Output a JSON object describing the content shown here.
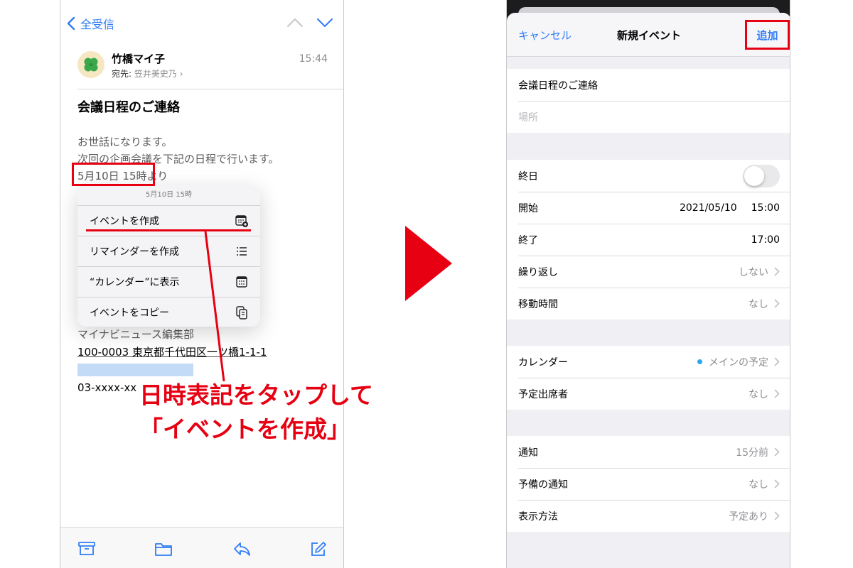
{
  "colors": {
    "accent_blue": "#2f7cf6",
    "annotation_red": "#e60012",
    "calendar_dot": "#29a8f0"
  },
  "mail": {
    "back_label": "全受信",
    "sender": {
      "name": "竹橋マイ子",
      "to_label": "宛先:",
      "to_name": "笠井美史乃",
      "time": "15:44",
      "avatar_icon": "clover-icon"
    },
    "subject": "会議日程のご連絡",
    "body": {
      "line1": "お世話になります。",
      "line2": "次回の企画会議を下記の日程で行います。",
      "date_link": "5月10日 15時",
      "date_suffix": "より",
      "sig1": "マイナビニュース編集部",
      "sig2": "100-0003 東京都千代田区一ツ橋1-1-1",
      "phone": "03-xxxx-xx"
    },
    "context_menu": {
      "header": "5月10日 15時",
      "items": [
        {
          "label": "イベントを作成",
          "icon": "calendar-add-icon"
        },
        {
          "label": "リマインダーを作成",
          "icon": "list-icon"
        },
        {
          "label": "“カレンダー”に表示",
          "icon": "calendar-icon"
        },
        {
          "label": "イベントをコピー",
          "icon": "copy-icon"
        }
      ]
    },
    "toolbar": [
      "archive-icon",
      "folder-icon",
      "reply-icon",
      "compose-icon"
    ]
  },
  "annotation": {
    "line1": "日時表記をタップして",
    "line2": "「イベントを作成」"
  },
  "event": {
    "cancel_label": "キャンセル",
    "title": "新規イベント",
    "add_label": "追加",
    "event_title": "会議日程のご連絡",
    "location_placeholder": "場所",
    "all_day_label": "終日",
    "all_day_on": false,
    "start_label": "開始",
    "start_date": "2021/05/10",
    "start_time": "15:00",
    "end_label": "終了",
    "end_time": "17:00",
    "repeat_label": "繰り返し",
    "repeat_value": "しない",
    "travel_label": "移動時間",
    "travel_value": "なし",
    "calendar_label": "カレンダー",
    "calendar_value": "メインの予定",
    "invitees_label": "予定出席者",
    "invitees_value": "なし",
    "alert_label": "通知",
    "alert_value": "15分前",
    "second_alert_label": "予備の通知",
    "second_alert_value": "なし",
    "show_as_label": "表示方法",
    "show_as_value": "予定あり"
  }
}
